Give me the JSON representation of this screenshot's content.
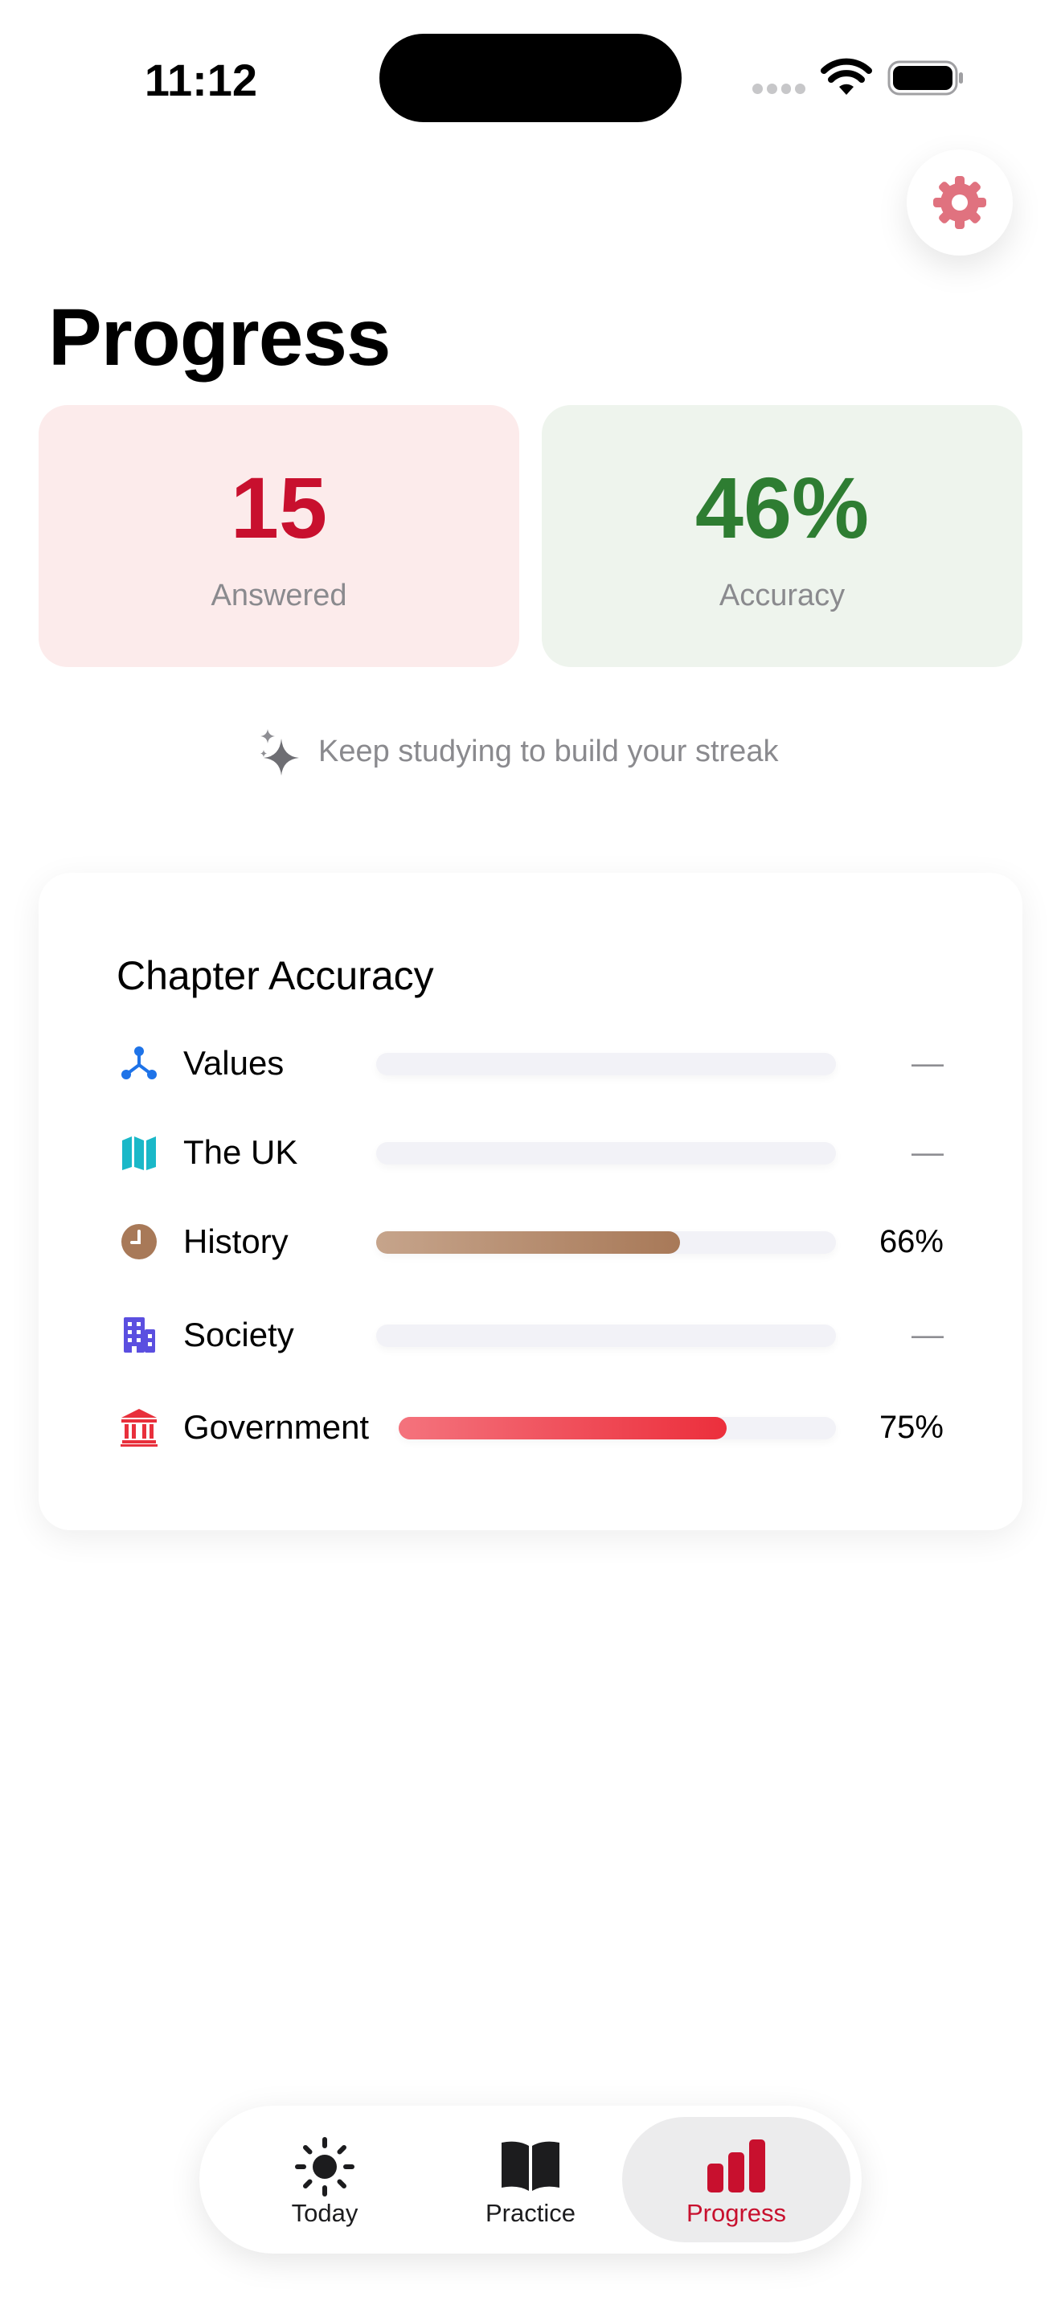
{
  "status_bar": {
    "time": "11:12"
  },
  "header": {
    "title": "Progress",
    "settings_icon": "gear-icon",
    "accent_color": "#e0727f"
  },
  "stats": {
    "answered": {
      "value": "15",
      "label": "Answered",
      "color": "#c8102e"
    },
    "accuracy": {
      "value": "46%",
      "label": "Accuracy",
      "color": "#2e7d32"
    }
  },
  "streak": {
    "icon": "sparkles-icon",
    "text": "Keep studying to build your streak"
  },
  "chapter_accuracy": {
    "title": "Chapter Accuracy",
    "rows": [
      {
        "label": "Values",
        "icon": "network-icon",
        "value": "—",
        "progress": null
      },
      {
        "label": "The UK",
        "icon": "map-icon",
        "value": "—",
        "progress": null
      },
      {
        "label": "History",
        "icon": "clock-icon",
        "value": "66%",
        "progress": 0.66
      },
      {
        "label": "Society",
        "icon": "building-icon",
        "value": "—",
        "progress": null
      },
      {
        "label": "Government",
        "icon": "bank-icon",
        "value": "75%",
        "progress": 0.75
      }
    ]
  },
  "tab_bar": {
    "tabs": [
      {
        "label": "Today",
        "icon": "sun-icon",
        "selected": false
      },
      {
        "label": "Practice",
        "icon": "book-icon",
        "selected": false
      },
      {
        "label": "Progress",
        "icon": "bar-chart-icon",
        "selected": true
      }
    ],
    "selected_color": "#c8102e"
  }
}
